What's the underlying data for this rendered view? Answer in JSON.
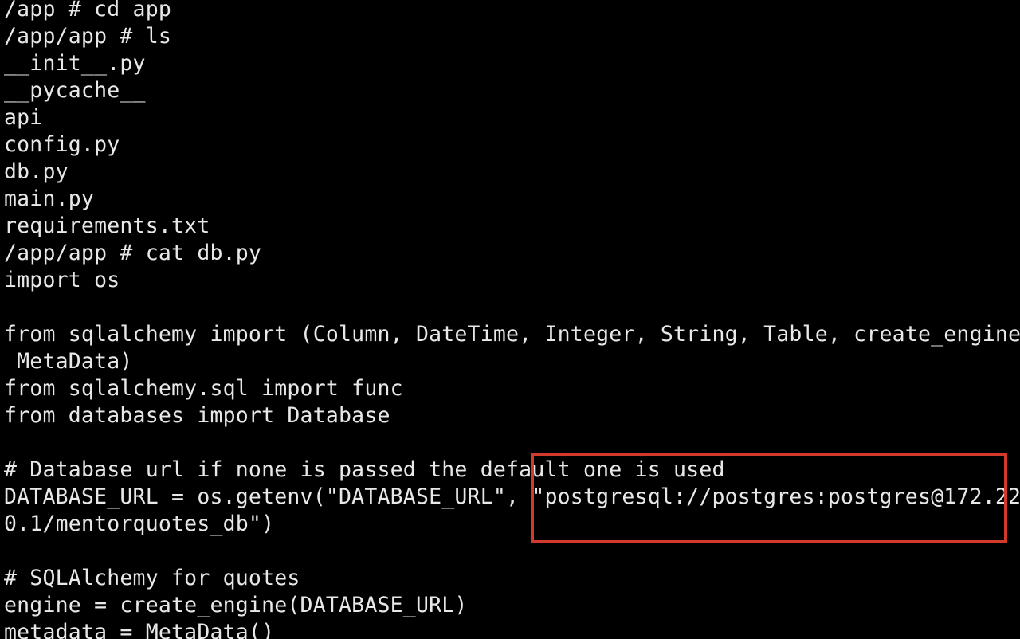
{
  "terminal": {
    "lines": [
      "/app # cd app",
      "/app/app # ls",
      "__init__.py",
      "__pycache__",
      "api",
      "config.py",
      "db.py",
      "main.py",
      "requirements.txt",
      "/app/app # cat db.py",
      "import os",
      "",
      "from sqlalchemy import (Column, DateTime, Integer, String, Table, create_engine,",
      " MetaData)",
      "from sqlalchemy.sql import func",
      "from databases import Database",
      "",
      "# Database url if none is passed the default one is used",
      "DATABASE_URL = os.getenv(\"DATABASE_URL\", \"postgresql://postgres:postgres@172.22.",
      "0.1/mentorquotes_db\")",
      "",
      "# SQLAlchemy for quotes",
      "engine = create_engine(DATABASE_URL)",
      "metadata = MetaData()"
    ]
  },
  "highlight": {
    "color": "#d23a2c"
  },
  "colors": {
    "background": "#000000",
    "text": "#e8e8e8"
  }
}
